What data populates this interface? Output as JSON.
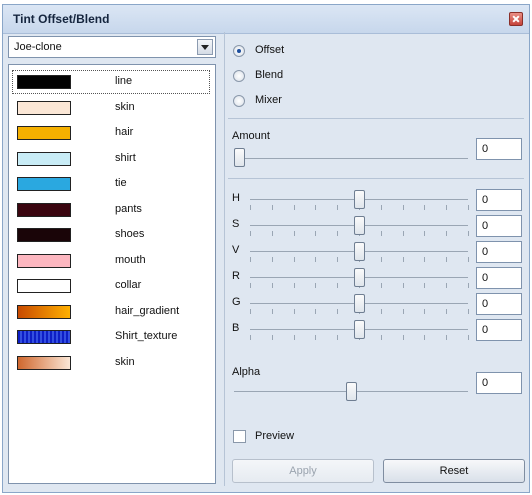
{
  "window": {
    "title": "Tint Offset/Blend"
  },
  "left": {
    "combo_value": "Joe-clone",
    "items": [
      {
        "label": "line",
        "color": "#000000"
      },
      {
        "label": "skin",
        "color": "#fbe7d6"
      },
      {
        "label": "hair",
        "color": "#f5b000"
      },
      {
        "label": "shirt",
        "color": "#c8ecf6"
      },
      {
        "label": "tie",
        "color": "#2aa8e0"
      },
      {
        "label": "pants",
        "color": "#3b0610"
      },
      {
        "label": "shoes",
        "color": "#1a0508"
      },
      {
        "label": "mouth",
        "color": "#fdb7c0"
      },
      {
        "label": "collar",
        "color": "#ffffff"
      },
      {
        "label": "hair_gradient",
        "color": "gradient:#c84a00-#ffb000"
      },
      {
        "label": "Shirt_texture",
        "color": "texture:#3a58e0"
      },
      {
        "label": "skin",
        "color": "gradient:#d0672e-#fbe7d6"
      }
    ]
  },
  "right": {
    "modes": {
      "offset": "Offset",
      "blend": "Blend",
      "mixer": "Mixer",
      "selected": "Offset"
    },
    "amount": {
      "label": "Amount",
      "value": "0",
      "level": 0.0
    },
    "channels": [
      {
        "label": "H",
        "value": "0",
        "level": 0.5
      },
      {
        "label": "S",
        "value": "0",
        "level": 0.5
      },
      {
        "label": "V",
        "value": "0",
        "level": 0.5
      },
      {
        "label": "R",
        "value": "0",
        "level": 0.5
      },
      {
        "label": "G",
        "value": "0",
        "level": 0.5
      },
      {
        "label": "B",
        "value": "0",
        "level": 0.5
      }
    ],
    "alpha": {
      "label": "Alpha",
      "value": "0",
      "level": 0.5
    },
    "preview_label": "Preview",
    "preview_checked": false,
    "apply_label": "Apply",
    "reset_label": "Reset"
  }
}
